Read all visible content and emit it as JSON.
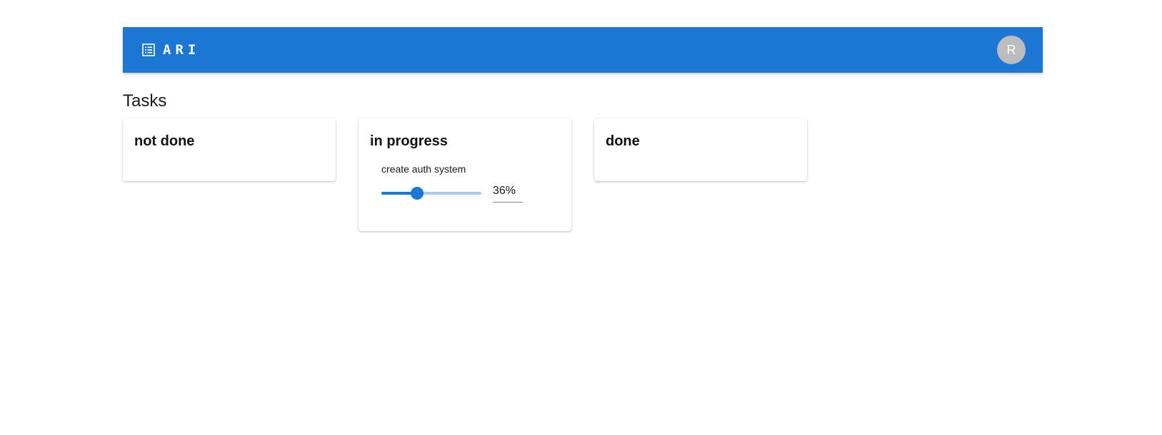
{
  "app": {
    "title": "ARI",
    "brand_icon": "list-alt-icon",
    "avatar_initial": "R",
    "accent_color": "#1c77d4"
  },
  "page": {
    "title": "Tasks"
  },
  "columns": [
    {
      "title": "not done",
      "tasks": []
    },
    {
      "title": "in progress",
      "tasks": [
        {
          "name": "create auth system",
          "progress": 36,
          "progress_label": "36%"
        }
      ]
    },
    {
      "title": "done",
      "tasks": []
    }
  ]
}
